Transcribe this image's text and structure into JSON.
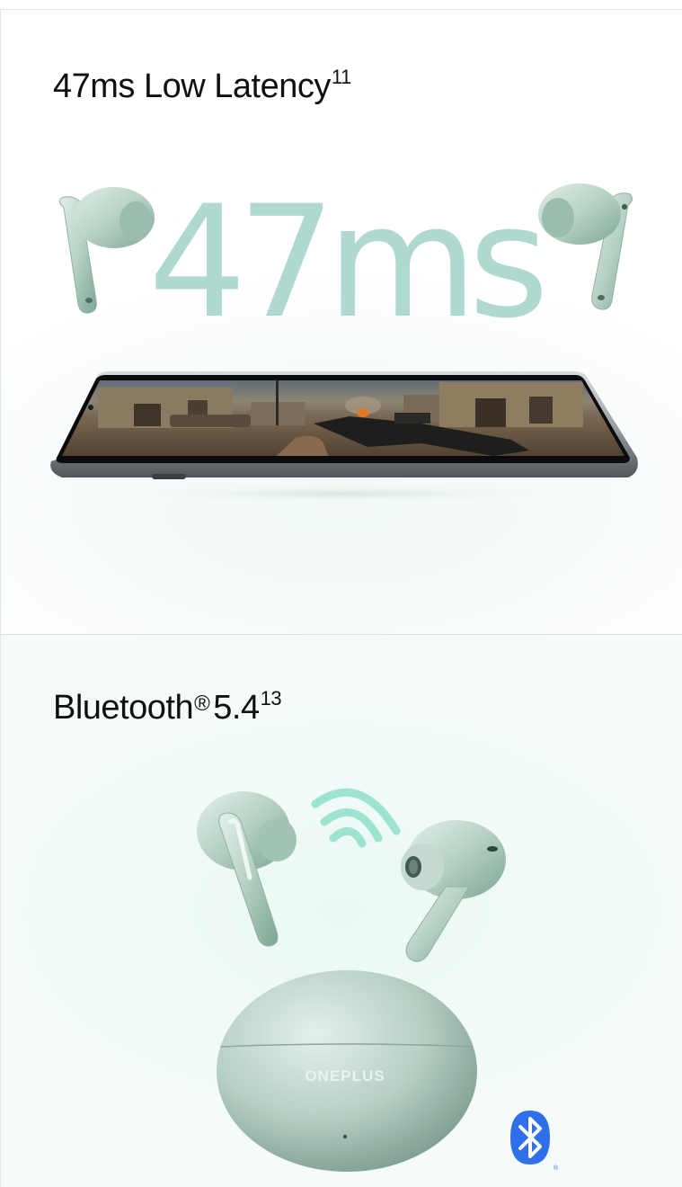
{
  "section_latency": {
    "title": "47ms Low Latency",
    "footnote": "11",
    "big_number": "47ms"
  },
  "section_bluetooth": {
    "title": "Bluetooth",
    "registered_mark": "®",
    "version": "5.4",
    "footnote": "13",
    "case_brand": "ONEPLUS"
  },
  "icons": [
    "earbud-left-icon",
    "earbud-right-icon",
    "smartphone-image",
    "wireless-signal-icon",
    "charging-case-image",
    "bluetooth-logo-icon"
  ],
  "colors": {
    "big_number": "#aed8d0",
    "earbud_green": "#b7d3c6",
    "signal": "#9ee3d1",
    "bluetooth_blue": "#2f6fea"
  }
}
